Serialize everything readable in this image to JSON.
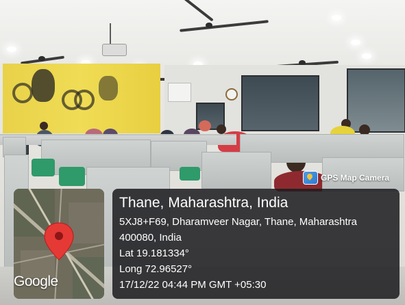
{
  "gps_badge": {
    "icon": "gps-map-camera-app-icon",
    "label": "GPS Map Camera"
  },
  "map": {
    "logo_text": "Google",
    "marker_icon": "location-pin-icon",
    "marker_color": "#e53935"
  },
  "location": {
    "title": "Thane, Maharashtra, India",
    "address_line1": "5XJ8+F69, Dharamveer Nagar, Thane, Maharashtra",
    "address_line2": "400080, India",
    "lat": "Lat 19.181334°",
    "long": "Long 72.96527°",
    "datetime": "17/12/22 04:44 PM GMT +05:30"
  },
  "colors": {
    "card_background": "#1c1c20",
    "card_text": "#ffffff",
    "mural_yellow": "#ecd64d",
    "chair_green": "#2f9a6a"
  }
}
